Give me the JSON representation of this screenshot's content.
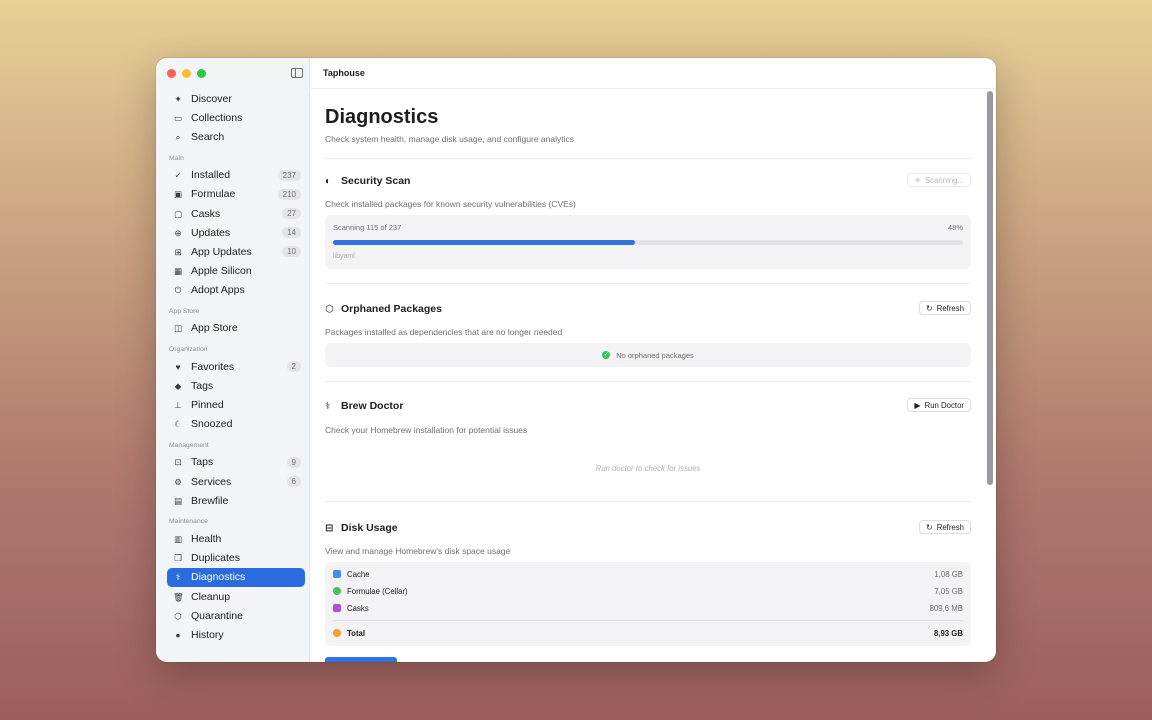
{
  "window": {
    "title": "Taphouse"
  },
  "sidebar": {
    "top": [
      {
        "label": "Discover",
        "icon": "sparkle-icon"
      },
      {
        "label": "Collections",
        "icon": "archive-icon"
      },
      {
        "label": "Search",
        "icon": "search-icon"
      }
    ],
    "sections": [
      {
        "label": "Main",
        "items": [
          {
            "label": "Installed",
            "count": "237",
            "icon": "check-circle-icon"
          },
          {
            "label": "Formulae",
            "count": "210",
            "icon": "terminal-icon"
          },
          {
            "label": "Casks",
            "count": "27",
            "icon": "window-icon"
          },
          {
            "label": "Updates",
            "count": "14",
            "icon": "arrow-up-circle-icon"
          },
          {
            "label": "App Updates",
            "count": "10",
            "icon": "app-updates-icon"
          },
          {
            "label": "Apple Silicon",
            "count": "",
            "icon": "chip-icon"
          },
          {
            "label": "Adopt Apps",
            "count": "",
            "icon": "adopt-icon"
          }
        ]
      },
      {
        "label": "App Store",
        "items": [
          {
            "label": "App Store",
            "count": "",
            "icon": "bag-icon"
          }
        ]
      },
      {
        "label": "Organization",
        "items": [
          {
            "label": "Favorites",
            "count": "2",
            "icon": "heart-icon"
          },
          {
            "label": "Tags",
            "count": "",
            "icon": "tag-icon"
          },
          {
            "label": "Pinned",
            "count": "",
            "icon": "pin-icon"
          },
          {
            "label": "Snoozed",
            "count": "",
            "icon": "moon-icon"
          }
        ]
      },
      {
        "label": "Management",
        "items": [
          {
            "label": "Taps",
            "count": "9",
            "icon": "taps-icon"
          },
          {
            "label": "Services",
            "count": "6",
            "icon": "gears-icon"
          },
          {
            "label": "Brewfile",
            "count": "",
            "icon": "document-icon"
          }
        ]
      },
      {
        "label": "Maintenance",
        "items": [
          {
            "label": "Health",
            "count": "",
            "icon": "heart-monitor-icon"
          },
          {
            "label": "Duplicates",
            "count": "",
            "icon": "duplicate-icon"
          },
          {
            "label": "Diagnostics",
            "count": "",
            "icon": "stethoscope-icon",
            "active": true
          },
          {
            "label": "Cleanup",
            "count": "",
            "icon": "trash-icon"
          },
          {
            "label": "Quarantine",
            "count": "",
            "icon": "shield-icon"
          },
          {
            "label": "History",
            "count": "",
            "icon": "clock-icon"
          }
        ]
      }
    ]
  },
  "main": {
    "title": "Diagnostics",
    "subtitle": "Check system health, manage disk usage, and configure analytics",
    "security": {
      "title": "Security Scan",
      "desc": "Check installed packages for known security vulnerabilities (CVEs)",
      "button": "Scanning...",
      "progress_label": "Scanning 115 of 237",
      "percent_label": "48%",
      "progress": 0.48,
      "current": "libyaml"
    },
    "orphaned": {
      "title": "Orphaned Packages",
      "desc": "Packages installed as dependencies that are no longer needed",
      "button": "Refresh",
      "status": "No orphaned packages"
    },
    "doctor": {
      "title": "Brew Doctor",
      "desc": "Check your Homebrew installation for potential issues",
      "button": "Run Doctor",
      "placeholder": "Run doctor to check for issues"
    },
    "disk": {
      "title": "Disk Usage",
      "desc": "View and manage Homebrew's disk space usage",
      "button": "Refresh",
      "rows": [
        {
          "label": "Cache",
          "value": "1,08 GB",
          "color": "#3d8ef0"
        },
        {
          "label": "Formulae (Cellar)",
          "value": "7,05 GB",
          "color": "#45c35a"
        },
        {
          "label": "Casks",
          "value": "809,6 MB",
          "color": "#b150d6"
        }
      ],
      "total_label": "Total",
      "total_value": "8,93 GB",
      "total_color": "#f0a030"
    }
  }
}
